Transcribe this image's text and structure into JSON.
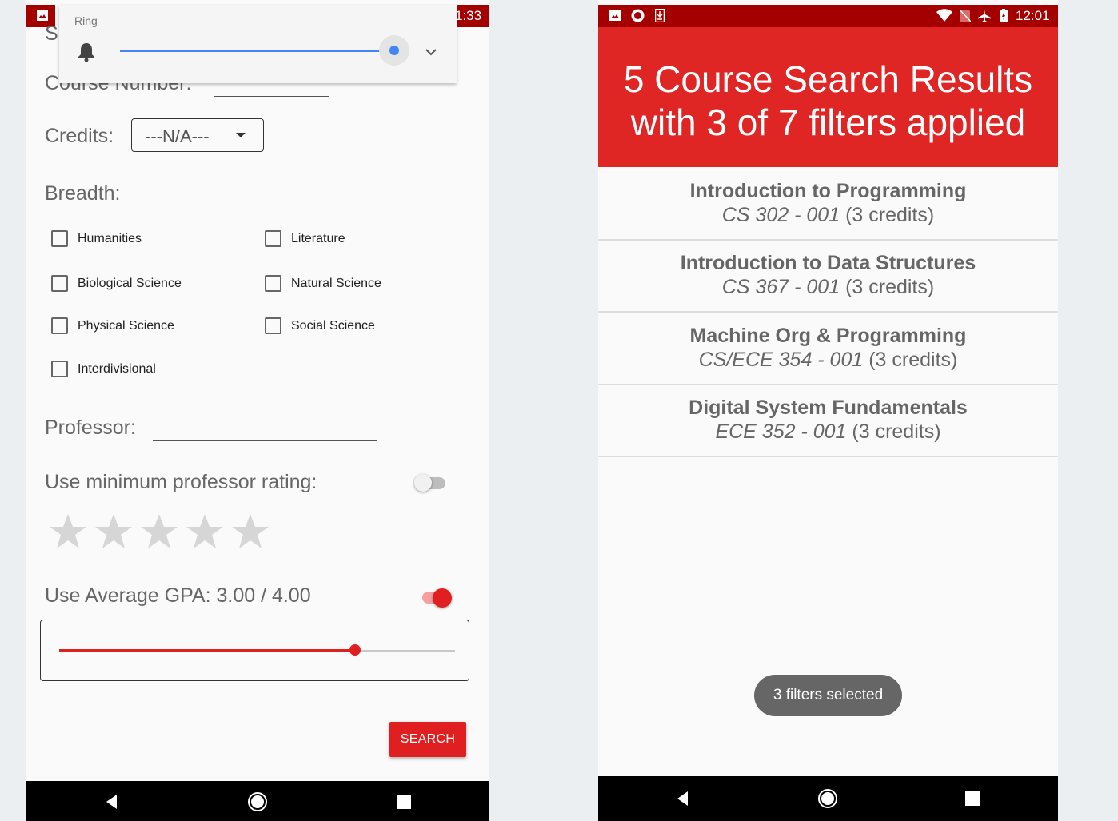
{
  "left": {
    "status": {
      "time_fragment": "1:33",
      "image_icon": "image-icon"
    },
    "ring_popup": {
      "title": "Ring",
      "volume_fraction": 1.0,
      "icon": "bell-icon",
      "expand_icon": "chevron-down-icon"
    },
    "course_number_label": "Course Number:",
    "partial_top_label": "S",
    "credits": {
      "label": "Credits:",
      "selected": "---N/A---"
    },
    "breadth": {
      "label": "Breadth:",
      "options": [
        {
          "label": "Humanities",
          "checked": false
        },
        {
          "label": "Literature",
          "checked": false
        },
        {
          "label": "Biological Science",
          "checked": false
        },
        {
          "label": "Natural Science",
          "checked": false
        },
        {
          "label": "Physical Science",
          "checked": false
        },
        {
          "label": "Social Science",
          "checked": false
        },
        {
          "label": "Interdivisional",
          "checked": false
        }
      ]
    },
    "professor_label": "Professor:",
    "min_rating": {
      "label": "Use minimum professor rating:",
      "enabled": false,
      "stars": 0,
      "max_stars": 5
    },
    "gpa": {
      "label": "Use Average GPA: 3.00 / 4.00",
      "enabled": true,
      "value": 3.0,
      "max": 4.0
    },
    "search_label": "SEARCH",
    "accent": "#e02020"
  },
  "right": {
    "status": {
      "time": "12:01"
    },
    "header": {
      "line1": "5 Course Search Results",
      "line2": "with 3 of 7 filters applied",
      "color": "#e02525"
    },
    "results": [
      {
        "name": "Introduction to Programming",
        "code": "CS 302 - 001",
        "credits": "(3 credits)"
      },
      {
        "name": "Introduction to Data Structures",
        "code": "CS 367 - 001",
        "credits": "(3 credits)"
      },
      {
        "name": "Machine Org & Programming",
        "code": "CS/ECE 354 - 001",
        "credits": "(3 credits)"
      },
      {
        "name": "Digital System Fundamentals",
        "code": "ECE 352 - 001",
        "credits": "(3 credits)"
      }
    ],
    "toast": "3 filters selected"
  }
}
